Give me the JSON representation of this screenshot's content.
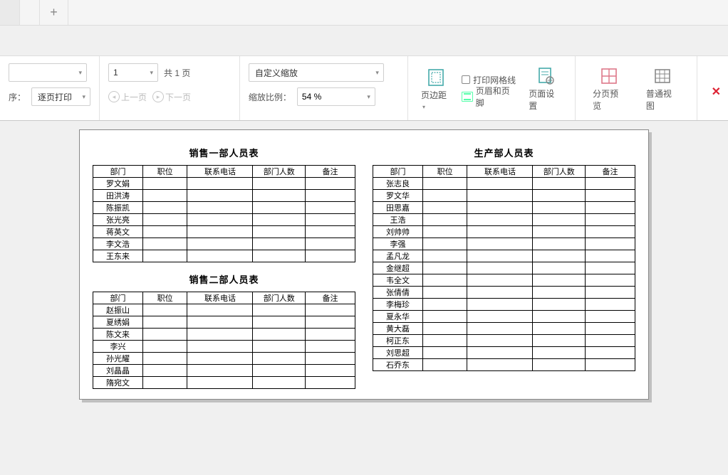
{
  "toolbar": {
    "order_label": "序：",
    "order_value": "逐页打印",
    "page_current": "1",
    "page_total_prefix": "共",
    "page_total": "1",
    "page_total_suffix": "页",
    "prev": "上一页",
    "next": "下一页",
    "zoom_mode": "自定义缩放",
    "zoom_ratio_label": "缩放比例：",
    "zoom_pct": "54 %",
    "margins": "页边距",
    "gridlines": "打印网格线",
    "header_footer": "页眉和页脚",
    "page_setup": "页面设置",
    "pagebreak_preview": "分页预览",
    "normal_view": "普通视图"
  },
  "tables": {
    "heads": [
      "部门",
      "职位",
      "联系电话",
      "部门人数",
      "备注"
    ],
    "sales1_title": "销售一部人员表",
    "sales1_rows": [
      "罗文娟",
      "田洪涛",
      "陈振凯",
      "张光亮",
      "蒋英文",
      "李文浩",
      "王东来"
    ],
    "sales2_title": "销售二部人员表",
    "sales2_rows": [
      "赵振山",
      "夏绣娟",
      "陈文来",
      "李兴",
      "孙光耀",
      "刘晶晶",
      "隋宛文"
    ],
    "prod_title": "生产部人员表",
    "prod_rows": [
      "张志良",
      "罗文华",
      "田思嘉",
      "王浩",
      "刘帅帅",
      "李强",
      "孟凡龙",
      "金继超",
      "韦全文",
      "张倩倩",
      "李梅珍",
      "夏永华",
      "黄大磊",
      "柯正东",
      "刘思超",
      "石乔东"
    ]
  }
}
